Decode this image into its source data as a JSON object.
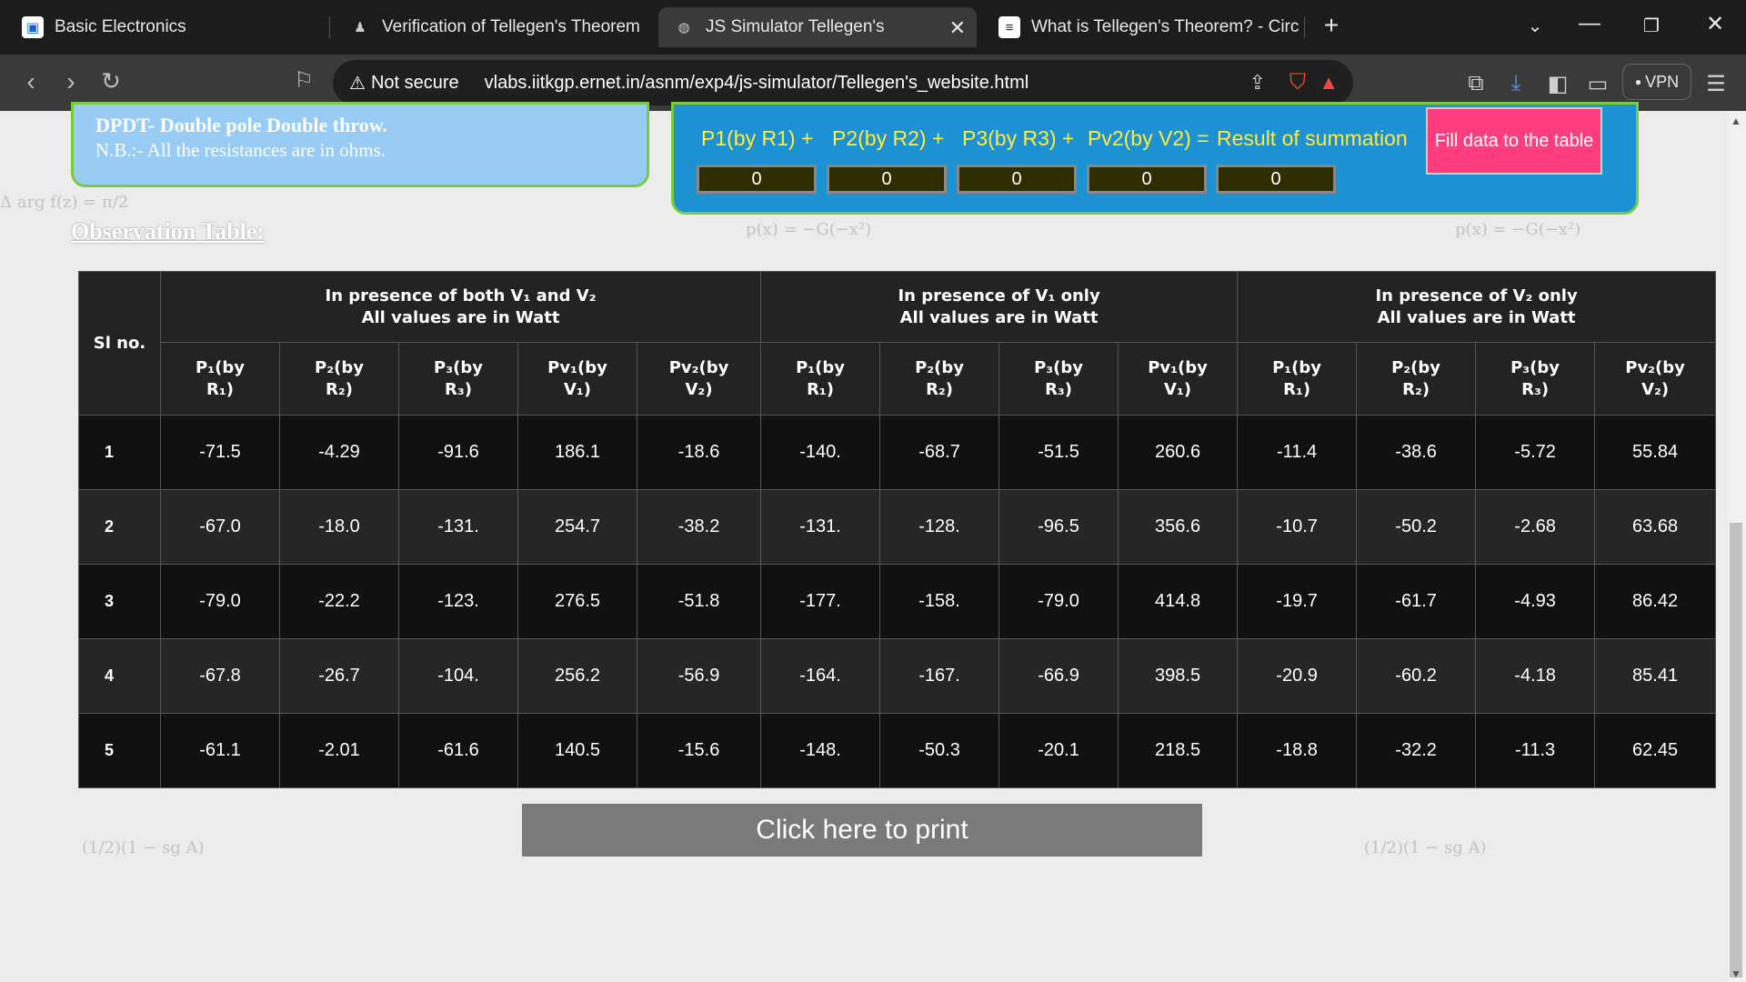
{
  "browser": {
    "tabs": [
      {
        "title": "Basic Electronics"
      },
      {
        "title": "Verification of Tellegen's Theorem"
      },
      {
        "title": "JS Simulator Tellegen's"
      },
      {
        "title": "What is Tellegen's Theorem? - Circu"
      }
    ],
    "new_tab": "+",
    "security_label": "Not secure",
    "url": "vlabs.iitkgp.ernet.in/asnm/exp4/js-simulator/Tellegen's_website.html",
    "vpn_label": "VPN"
  },
  "info": {
    "line1": "DPDT- Double pole Double throw.",
    "line2": "N.B.:- All the resistances are in ohms."
  },
  "summation": {
    "labels": [
      "P1(by R1) +",
      "P2(by R2) +",
      "P3(by R3) +",
      "Pv2(by V2) =",
      "Result of summation"
    ],
    "values": [
      "0",
      "0",
      "0",
      "0",
      "0"
    ],
    "fill_button": "Fill data to the table"
  },
  "observation_title": "Observation Table:",
  "table": {
    "sl_header": "Sl no.",
    "groups": [
      {
        "line1": "In presence of both V₁ and V₂",
        "line2": "All values are in Watt"
      },
      {
        "line1": "In presence of V₁ only",
        "line2": "All values are in Watt"
      },
      {
        "line1": "In presence of V₂ only",
        "line2": "All values are in Watt"
      }
    ],
    "columns": [
      [
        "P₁(by",
        "R₁)"
      ],
      [
        "P₂(by",
        "R₂)"
      ],
      [
        "P₃(by",
        "R₃)"
      ],
      [
        "Pv₁(by",
        "V₁)"
      ],
      [
        "Pv₂(by",
        "V₂)"
      ],
      [
        "P₁(by",
        "R₁)"
      ],
      [
        "P₂(by",
        "R₂)"
      ],
      [
        "P₃(by",
        "R₃)"
      ],
      [
        "Pv₁(by",
        "V₁)"
      ],
      [
        "P₁(by",
        "R₁)"
      ],
      [
        "P₂(by",
        "R₂)"
      ],
      [
        "P₃(by",
        "R₃)"
      ],
      [
        "Pv₂(by",
        "V₂)"
      ]
    ],
    "rows": [
      [
        "1",
        "-71.5",
        "-4.29",
        "-91.6",
        "186.1",
        "-18.6",
        "-140.",
        "-68.7",
        "-51.5",
        "260.6",
        "-11.4",
        "-38.6",
        "-5.72",
        "55.84"
      ],
      [
        "2",
        "-67.0",
        "-18.0",
        "-131.",
        "254.7",
        "-38.2",
        "-131.",
        "-128.",
        "-96.5",
        "356.6",
        "-10.7",
        "-50.2",
        "-2.68",
        "63.68"
      ],
      [
        "3",
        "-79.0",
        "-22.2",
        "-123.",
        "276.5",
        "-51.8",
        "-177.",
        "-158.",
        "-79.0",
        "414.8",
        "-19.7",
        "-61.7",
        "-4.93",
        "86.42"
      ],
      [
        "4",
        "-67.8",
        "-26.7",
        "-104.",
        "256.2",
        "-56.9",
        "-164.",
        "-167.",
        "-66.9",
        "398.5",
        "-20.9",
        "-60.2",
        "-4.18",
        "85.41"
      ],
      [
        "5",
        "-61.1",
        "-2.01",
        "-61.6",
        "140.5",
        "-15.6",
        "-148.",
        "-50.3",
        "-20.1",
        "218.5",
        "-18.8",
        "-32.2",
        "-11.3",
        "62.45"
      ]
    ]
  },
  "print_button": "Click here to print"
}
